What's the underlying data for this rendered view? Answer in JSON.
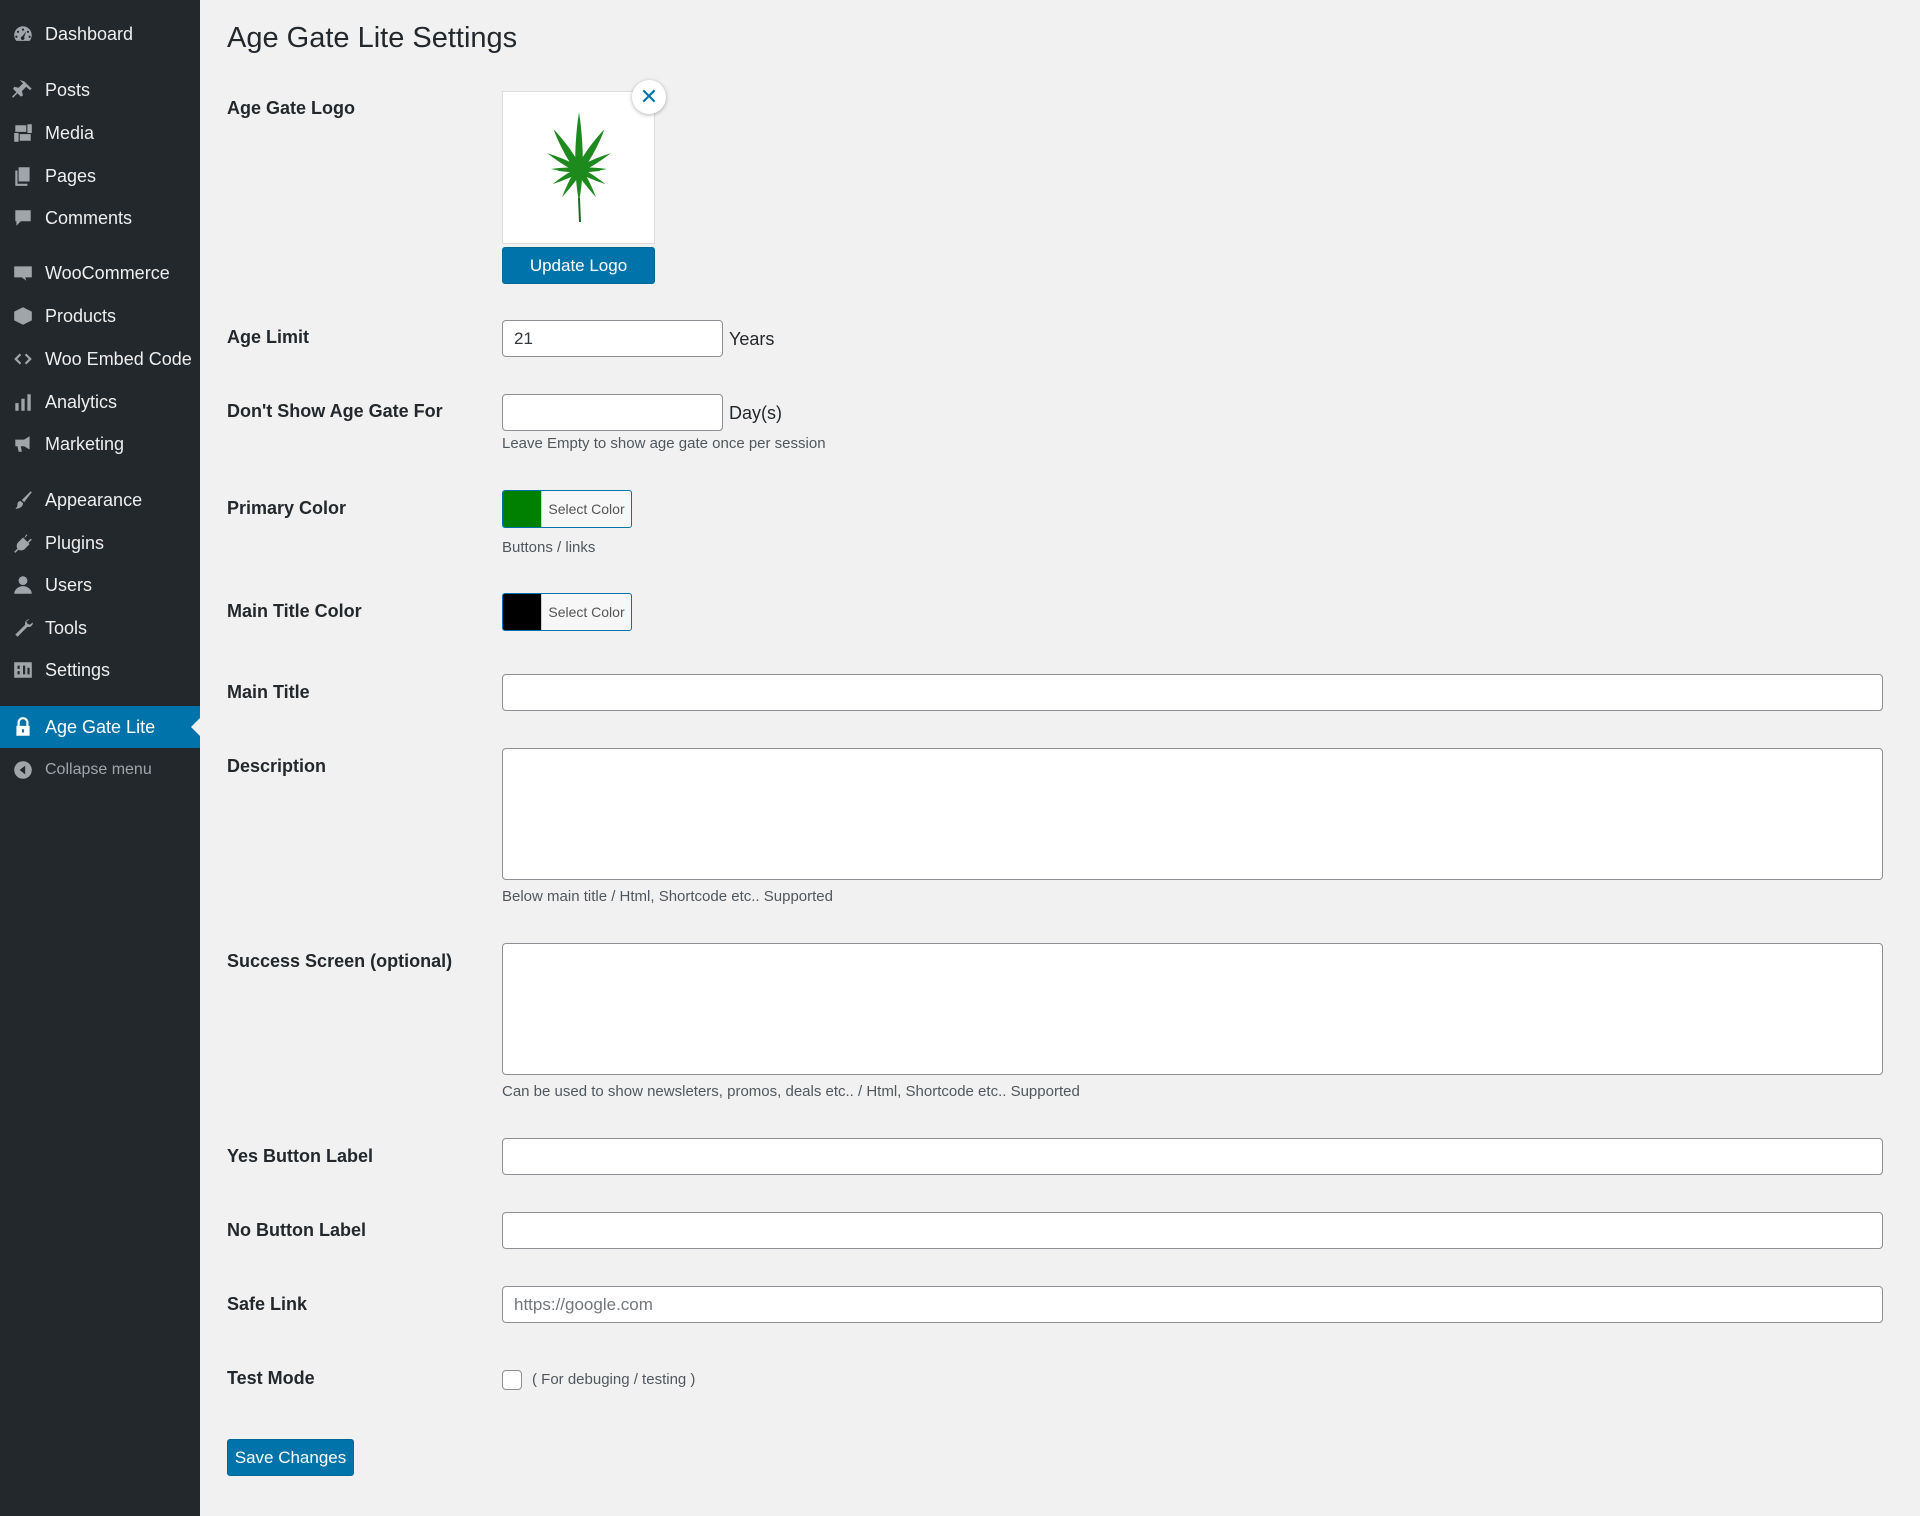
{
  "sidebar": {
    "items": [
      {
        "label": "Dashboard",
        "icon": "dashboard-icon"
      },
      {
        "label": "Posts",
        "icon": "pin-icon"
      },
      {
        "label": "Media",
        "icon": "media-icon"
      },
      {
        "label": "Pages",
        "icon": "pages-icon"
      },
      {
        "label": "Comments",
        "icon": "comment-icon"
      },
      {
        "label": "WooCommerce",
        "icon": "woo-icon"
      },
      {
        "label": "Products",
        "icon": "box-icon"
      },
      {
        "label": "Woo Embed Code",
        "icon": "code-icon"
      },
      {
        "label": "Analytics",
        "icon": "bar-chart-icon"
      },
      {
        "label": "Marketing",
        "icon": "megaphone-icon"
      },
      {
        "label": "Appearance",
        "icon": "brush-icon"
      },
      {
        "label": "Plugins",
        "icon": "plug-icon"
      },
      {
        "label": "Users",
        "icon": "user-icon"
      },
      {
        "label": "Tools",
        "icon": "wrench-icon"
      },
      {
        "label": "Settings",
        "icon": "settings-icon"
      },
      {
        "label": "Age Gate Lite",
        "icon": "lock-icon",
        "active": true
      }
    ],
    "collapse_label": "Collapse menu"
  },
  "page": {
    "title": "Age Gate Lite Settings"
  },
  "fields": {
    "logo": {
      "label": "Age Gate Logo",
      "button": "Update Logo",
      "remove_icon": "close-icon",
      "image": "cannabis-leaf"
    },
    "age_limit": {
      "label": "Age Limit",
      "value": "21",
      "suffix": "Years"
    },
    "dont_show": {
      "label": "Don't Show Age Gate For",
      "value": "",
      "suffix": "Day(s)",
      "help": "Leave Empty to show age gate once per session"
    },
    "primary_color": {
      "label": "Primary Color",
      "button": "Select Color",
      "color": "#008000",
      "help": "Buttons / links"
    },
    "title_color": {
      "label": "Main Title Color",
      "button": "Select Color",
      "color": "#000000"
    },
    "main_title": {
      "label": "Main Title",
      "value": ""
    },
    "description": {
      "label": "Description",
      "value": "",
      "help": "Below main title / Html, Shortcode etc.. Supported"
    },
    "success_screen": {
      "label": "Success Screen (optional)",
      "value": "",
      "help": "Can be used to show newsleters, promos, deals etc.. / Html, Shortcode etc.. Supported"
    },
    "yes_label": {
      "label": "Yes Button Label",
      "value": ""
    },
    "no_label": {
      "label": "No Button Label",
      "value": ""
    },
    "safe_link": {
      "label": "Safe Link",
      "value": "",
      "placeholder": "https://google.com"
    },
    "test_mode": {
      "label": "Test Mode",
      "checked": false,
      "help": "( For debuging / testing )"
    }
  },
  "save_button": "Save Changes",
  "colors": {
    "sidebar_bg": "#23282d",
    "accent": "#0073aa",
    "page_bg": "#f1f1f1"
  }
}
